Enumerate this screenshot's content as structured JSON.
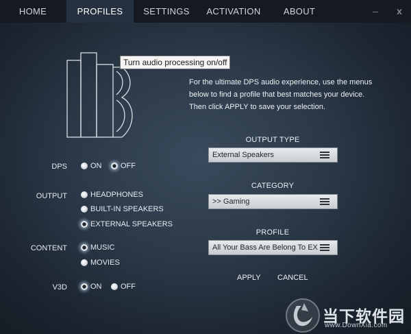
{
  "nav": {
    "tabs": [
      {
        "label": "HOME"
      },
      {
        "label": "PROFILES"
      },
      {
        "label": "SETTINGS"
      },
      {
        "label": "ACTIVATION"
      },
      {
        "label": "ABOUT"
      }
    ],
    "active_tab": "PROFILES",
    "minimize_label": "–",
    "close_label": "x"
  },
  "tooltip": "Turn audio processing on/off",
  "description": "For the ultimate DPS audio experience, use the menus below to find a profile that best matches your device. Then click APPLY to save your selection.",
  "controls": {
    "dps": {
      "label": "DPS",
      "options": [
        "ON",
        "OFF"
      ],
      "selected": "OFF"
    },
    "output": {
      "label": "OUTPUT",
      "options": [
        "HEADPHONES",
        "BUILT-IN SPEAKERS",
        "EXTERNAL SPEAKERS"
      ],
      "selected": "EXTERNAL SPEAKERS"
    },
    "content": {
      "label": "CONTENT",
      "options": [
        "MUSIC",
        "MOVIES"
      ],
      "selected": "MUSIC"
    },
    "v3d": {
      "label": "V3D",
      "options": [
        "ON",
        "OFF"
      ],
      "selected": "ON"
    }
  },
  "selectors": {
    "output_type": {
      "label": "OUTPUT TYPE",
      "value": "External Speakers"
    },
    "category": {
      "label": "CATEGORY",
      "value": ">> Gaming"
    },
    "profile": {
      "label": "PROFILE",
      "value": "All Your Bass Are Belong To EX"
    }
  },
  "actions": {
    "apply": "APPLY",
    "cancel": "CANCEL"
  },
  "watermark": {
    "name": "当下软件园",
    "url": "www.DownXia.com"
  },
  "colors": {
    "accent_glow": "#cfe8ff",
    "background": "#2a3746",
    "nav_active": "#253140"
  }
}
